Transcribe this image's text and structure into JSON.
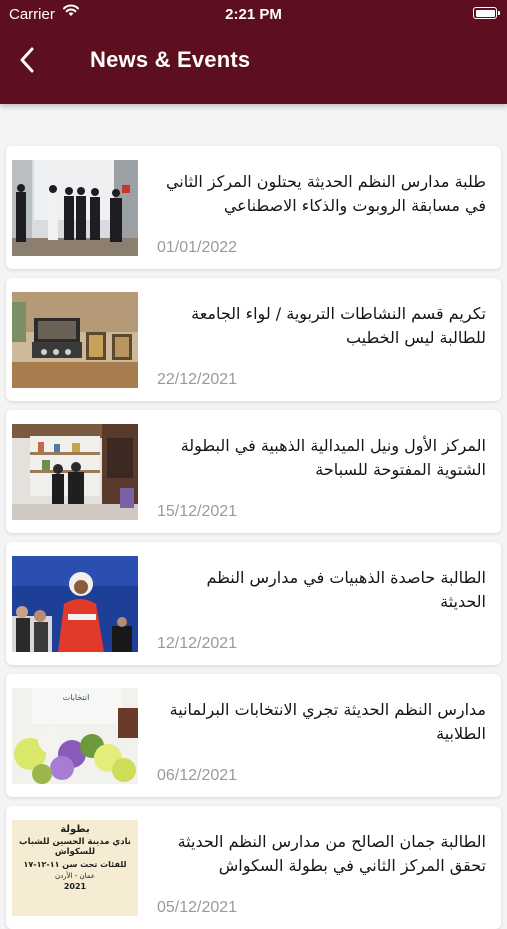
{
  "status_bar": {
    "carrier": "Carrier",
    "time": "2:21 PM"
  },
  "header": {
    "title": "News & Events"
  },
  "colors": {
    "header_bg": "#5e0f1f",
    "date_text": "#9a9a9a"
  },
  "news": [
    {
      "title": "طلبة مدارس النظم الحديثة يحتلون المركز الثاني في مسابقة الروبوت والذكاء الاصطناعي",
      "date": "01/01/2022"
    },
    {
      "title": "تكريم قسم النشاطات التربوية / لواء الجامعة للطالبة ليس الخطيب",
      "date": "22/12/2021"
    },
    {
      "title": "المركز الأول ونيل الميدالية الذهبية في البطولة الشتوية المفتوحة للسباحة",
      "date": "15/12/2021"
    },
    {
      "title": "الطالبة حاصدة الذهبيات في مدارس النظم الحديثة",
      "date": "12/12/2021"
    },
    {
      "title": "مدارس النظم الحديثة تجري الانتخابات البرلمانية الطلابية",
      "date": "06/12/2021"
    },
    {
      "title": "الطالبة جمان الصالح من مدارس النظم الحديثة تحقق المركز الثاني في بطولة السكواش",
      "date": "05/12/2021"
    }
  ],
  "poster": {
    "line1": "بطولة",
    "line2": "نادي مدينة الحسين للشباب للسكواش",
    "line3": "للفئات تحت سن ١١-١٢-١٧",
    "line4": "عمان - الأردن",
    "line5": "2021"
  }
}
